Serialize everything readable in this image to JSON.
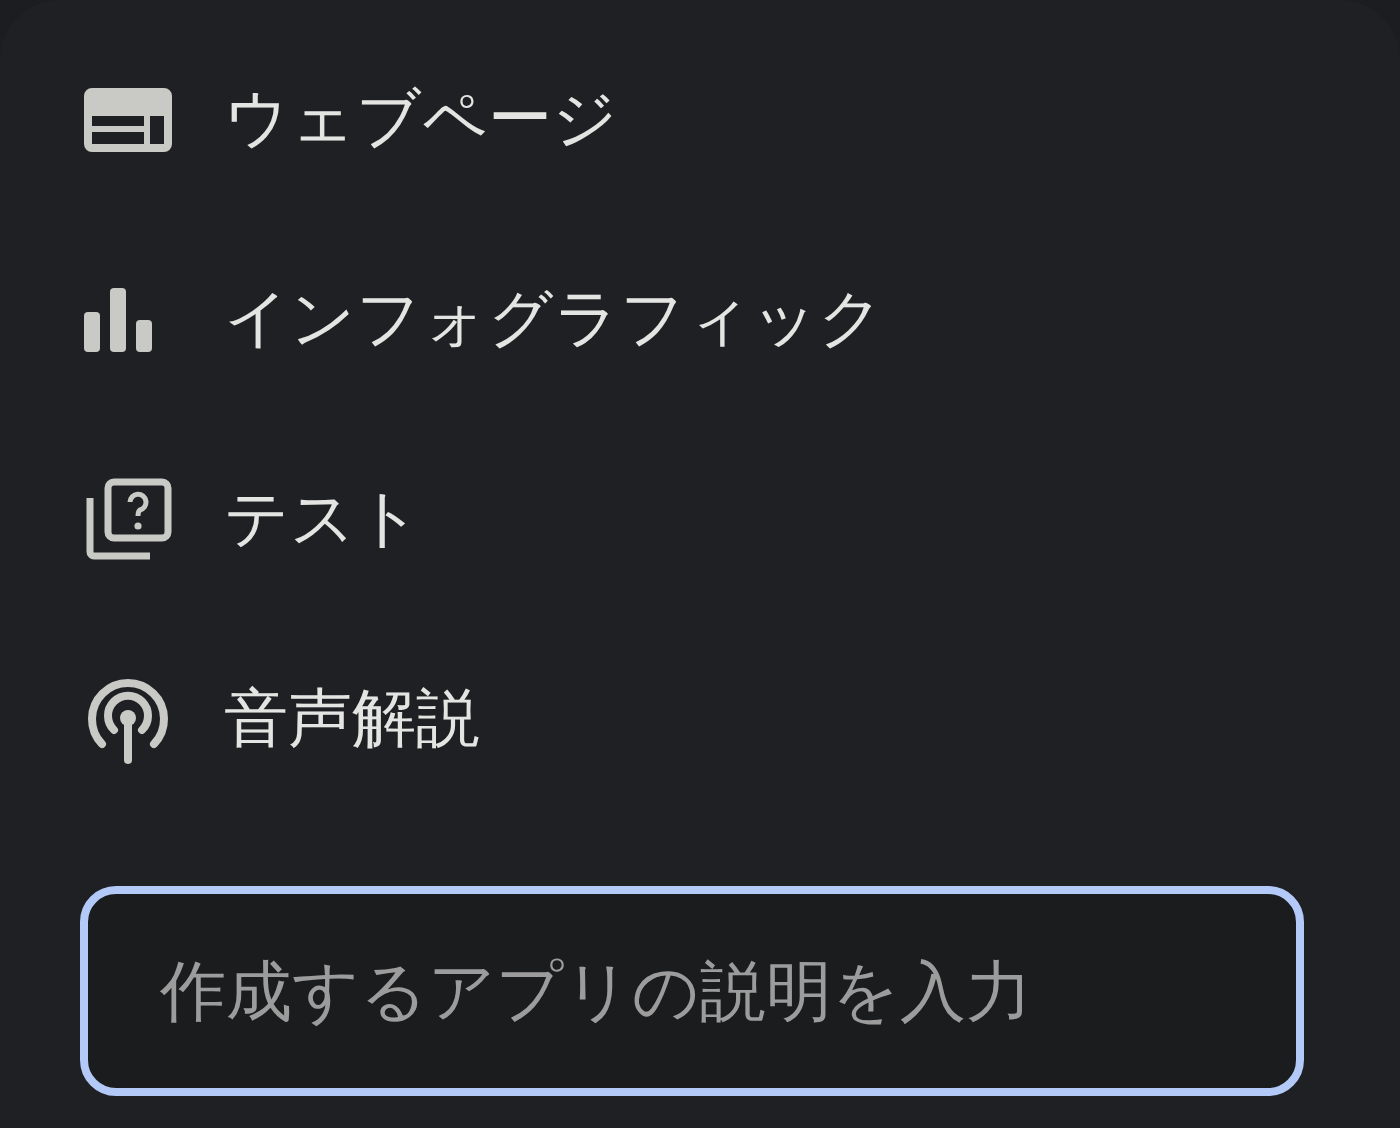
{
  "menu": {
    "items": [
      {
        "kind": "webpage",
        "label": "ウェブページ"
      },
      {
        "kind": "infographic",
        "label": "インフォグラフィック"
      },
      {
        "kind": "quiz",
        "label": "テスト"
      },
      {
        "kind": "audio",
        "label": "音声解説"
      }
    ]
  },
  "prompt": {
    "placeholder": "作成するアプリの説明を入力"
  }
}
